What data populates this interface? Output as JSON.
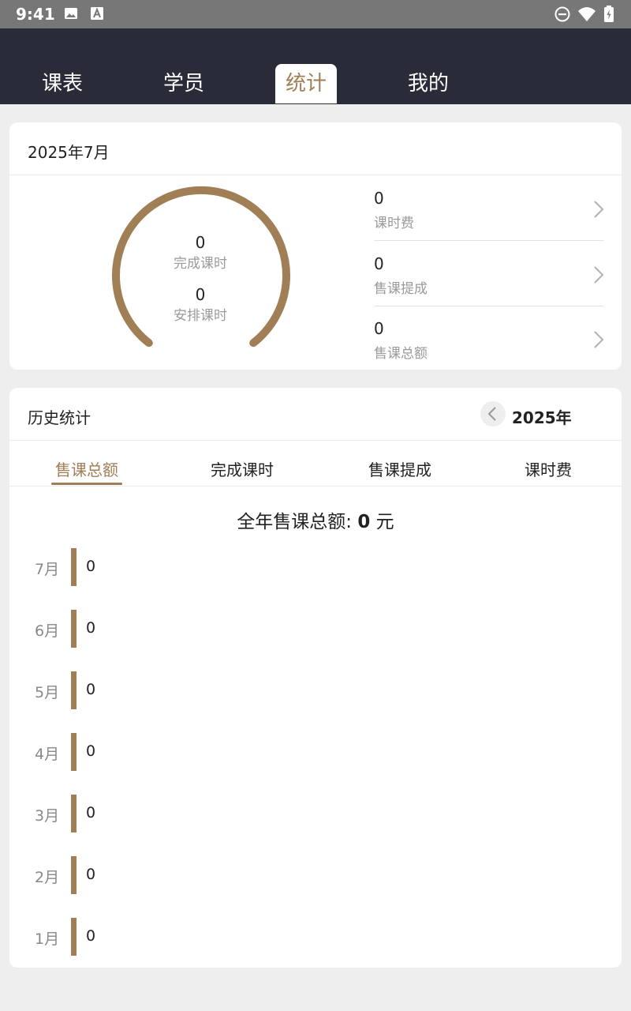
{
  "status_bar": {
    "time": "9:41"
  },
  "nav_tabs": [
    {
      "label": "课表"
    },
    {
      "label": "学员"
    },
    {
      "label": "统计",
      "active": true
    },
    {
      "label": "我的"
    }
  ],
  "monthly": {
    "title": "2025年7月",
    "gauge": {
      "completed_value": "0",
      "completed_label": "完成课时",
      "scheduled_value": "0",
      "scheduled_label": "安排课时"
    },
    "metrics": [
      {
        "value": "0",
        "label": "课时费"
      },
      {
        "value": "0",
        "label": "售课提成"
      },
      {
        "value": "0",
        "label": "售课总额"
      }
    ]
  },
  "history": {
    "title": "历史统计",
    "year": "2025年",
    "tabs": [
      {
        "label": "售课总额",
        "active": true
      },
      {
        "label": "完成课时"
      },
      {
        "label": "售课提成"
      },
      {
        "label": "课时费"
      }
    ],
    "annual_prefix": "全年售课总额: ",
    "annual_value": "0",
    "annual_suffix": " 元",
    "months": [
      {
        "label": "7月",
        "value": "0"
      },
      {
        "label": "6月",
        "value": "0"
      },
      {
        "label": "5月",
        "value": "0"
      },
      {
        "label": "4月",
        "value": "0"
      },
      {
        "label": "3月",
        "value": "0"
      },
      {
        "label": "2月",
        "value": "0"
      },
      {
        "label": "1月",
        "value": "0"
      }
    ]
  },
  "colors": {
    "accent": "#a07e56",
    "nav_background": "#2a2b38",
    "page_background": "#eeeeee"
  }
}
